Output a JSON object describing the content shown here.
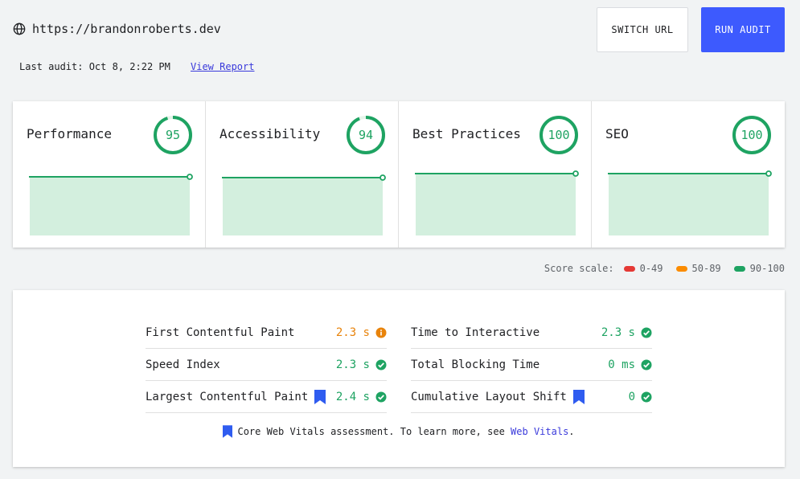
{
  "header": {
    "url": "https://brandonroberts.dev",
    "last_audit": "Last audit: Oct 8, 2:22 PM",
    "view_report": "View Report",
    "switch_url": "SWITCH URL",
    "run_audit": "RUN AUDIT"
  },
  "categories": [
    {
      "title": "Performance",
      "score": "95",
      "score_value": 95
    },
    {
      "title": "Accessibility",
      "score": "94",
      "score_value": 94
    },
    {
      "title": "Best Practices",
      "score": "100",
      "score_value": 100
    },
    {
      "title": "SEO",
      "score": "100",
      "score_value": 100
    }
  ],
  "score_scale": {
    "label": "Score scale:",
    "ranges": [
      {
        "label": "0-49",
        "color": "#e53935"
      },
      {
        "label": "50-89",
        "color": "#fb8c00"
      },
      {
        "label": "90-100",
        "color": "#1ea362"
      }
    ]
  },
  "metrics": {
    "left": [
      {
        "name": "First Contentful Paint",
        "value": "2.3 s",
        "status": "average",
        "cwv": false
      },
      {
        "name": "Speed Index",
        "value": "2.3 s",
        "status": "good",
        "cwv": false
      },
      {
        "name": "Largest Contentful Paint",
        "value": "2.4 s",
        "status": "good",
        "cwv": true
      }
    ],
    "right": [
      {
        "name": "Time to Interactive",
        "value": "2.3 s",
        "status": "good",
        "cwv": false
      },
      {
        "name": "Total Blocking Time",
        "value": "0 ms",
        "status": "good",
        "cwv": false
      },
      {
        "name": "Cumulative Layout Shift",
        "value": "0",
        "status": "good",
        "cwv": true
      }
    ]
  },
  "footnote": {
    "text": "Core Web Vitals assessment. To learn more, see",
    "link": "Web Vitals",
    "end": "."
  },
  "colors": {
    "accent": "#3d5afe",
    "good": "#1ea362",
    "average": "#e8830b",
    "cwv_icon": "#2f5cf0"
  }
}
